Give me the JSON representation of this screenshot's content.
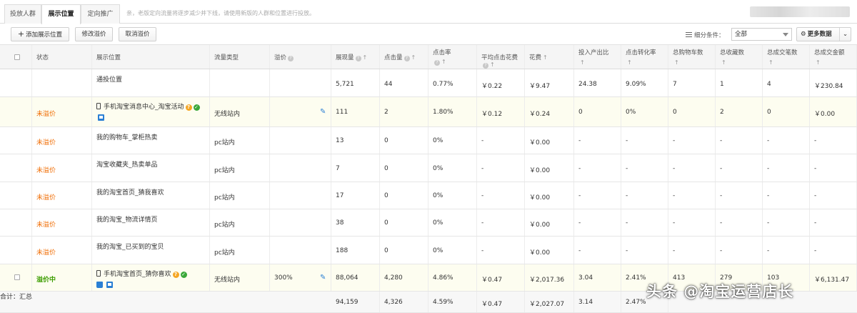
{
  "tabs": [
    {
      "label": "投放人群"
    },
    {
      "label": "展示位置"
    },
    {
      "label": "定向推广"
    }
  ],
  "notice": "亲，老版定向流量将逐步减少并下线，请使用新版的人群和位置进行投放。",
  "toolbar": {
    "add_label": "添加展示位置",
    "modify_label": "修改溢价",
    "cancel_label": "取消溢价",
    "filter_label": "细分条件：",
    "filter_value": "全部",
    "more_label": "更多数据"
  },
  "columns": [
    "状态",
    "展示位置",
    "流量类型",
    "溢价",
    "展现量",
    "点击量",
    "点击率",
    "平均点击花费",
    "花费",
    "投入产出比",
    "点击转化率",
    "总购物车数",
    "总收藏数",
    "总成交笔数",
    "总成交金额"
  ],
  "rows": [
    {
      "status": "",
      "position": "通投位置",
      "traffic": "",
      "premium": "",
      "impressions": "5,721",
      "clicks": "44",
      "ctr": "0.77%",
      "cpc": "￥0.22",
      "cost": "￥9.47",
      "roi": "24.38",
      "cvr": "9.09%",
      "carts": "7",
      "favs": "1",
      "orders": "4",
      "gmv": "￥230.84"
    },
    {
      "status": "未溢价",
      "position": "手机淘宝消息中心_淘宝活动",
      "traffic": "无线站内",
      "premium": "",
      "impressions": "111",
      "clicks": "2",
      "ctr": "1.80%",
      "cpc": "￥0.12",
      "cost": "￥0.24",
      "roi": "0",
      "cvr": "0%",
      "carts": "0",
      "favs": "2",
      "orders": "0",
      "gmv": "￥0.00"
    },
    {
      "status": "未溢价",
      "position": "我的购物车_掌柜热卖",
      "traffic": "pc站内",
      "premium": "",
      "impressions": "13",
      "clicks": "0",
      "ctr": "0%",
      "cpc": "-",
      "cost": "￥0.00",
      "roi": "-",
      "cvr": "-",
      "carts": "-",
      "favs": "-",
      "orders": "-",
      "gmv": "-"
    },
    {
      "status": "未溢价",
      "position": "淘宝收藏夹_热卖单品",
      "traffic": "pc站内",
      "premium": "",
      "impressions": "7",
      "clicks": "0",
      "ctr": "0%",
      "cpc": "-",
      "cost": "￥0.00",
      "roi": "-",
      "cvr": "-",
      "carts": "-",
      "favs": "-",
      "orders": "-",
      "gmv": "-"
    },
    {
      "status": "未溢价",
      "position": "我的淘宝首页_猜我喜欢",
      "traffic": "pc站内",
      "premium": "",
      "impressions": "17",
      "clicks": "0",
      "ctr": "0%",
      "cpc": "-",
      "cost": "￥0.00",
      "roi": "-",
      "cvr": "-",
      "carts": "-",
      "favs": "-",
      "orders": "-",
      "gmv": "-"
    },
    {
      "status": "未溢价",
      "position": "我的淘宝_物流详情页",
      "traffic": "pc站内",
      "premium": "",
      "impressions": "38",
      "clicks": "0",
      "ctr": "0%",
      "cpc": "-",
      "cost": "￥0.00",
      "roi": "-",
      "cvr": "-",
      "carts": "-",
      "favs": "-",
      "orders": "-",
      "gmv": "-"
    },
    {
      "status": "未溢价",
      "position": "我的淘宝_已买到的宝贝",
      "traffic": "pc站内",
      "premium": "",
      "impressions": "188",
      "clicks": "0",
      "ctr": "0%",
      "cpc": "-",
      "cost": "￥0.00",
      "roi": "-",
      "cvr": "-",
      "carts": "-",
      "favs": "-",
      "orders": "-",
      "gmv": "-"
    },
    {
      "status": "溢价中",
      "position": "手机淘宝首页_猜你喜欢",
      "traffic": "无线站内",
      "premium": "300%",
      "impressions": "88,064",
      "clicks": "4,280",
      "ctr": "4.86%",
      "cpc": "￥0.47",
      "cost": "￥2,017.36",
      "roi": "3.04",
      "cvr": "2.41%",
      "carts": "413",
      "favs": "279",
      "orders": "103",
      "gmv": "￥6,131.47"
    }
  ],
  "total": {
    "label": "合计：汇总",
    "impressions": "94,159",
    "clicks": "4,326",
    "ctr": "4.59%",
    "cpc": "￥0.47",
    "cost": "￥2,027.07",
    "roi": "3.14",
    "cvr": "2.47%"
  },
  "watermark": "头条 @淘宝运营店长"
}
